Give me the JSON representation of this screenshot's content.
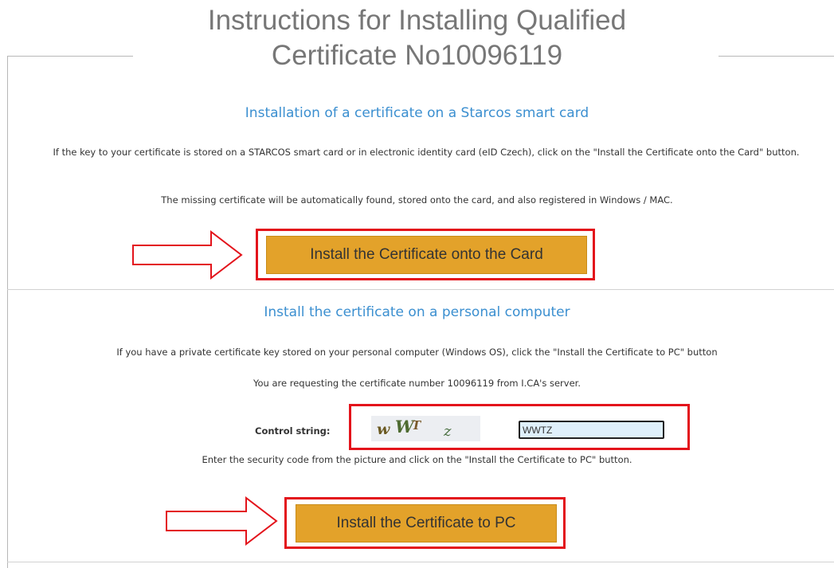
{
  "page": {
    "title": "Instructions for Installing Qualified\nCertificate No10096119"
  },
  "card_section": {
    "title": "Installation of a certificate on a Starcos smart card",
    "paragraph_1": "If the key to your certificate is stored on a STARCOS smart card or in electronic identity card (eID Czech), click on the \"Install the Certificate onto the Card\" button.",
    "paragraph_2": "The missing certificate will be automatically found, stored onto the card, and also registered in Windows / MAC.",
    "button_label": "Install the Certificate onto the Card"
  },
  "pc_section": {
    "title": "Install the certificate on a personal computer",
    "paragraph_1": "If you have a private certificate key stored on your personal computer (Windows OS), click the \"Install the Certificate to PC\" button",
    "paragraph_2": "You are requesting the certificate number 10096119 from I.CA's server.",
    "control_string_label": "Control string:",
    "captcha_input_value": "WWTZ",
    "paragraph_3": "Enter the security code from the picture and click on the \"Install the Certificate to PC\" button.",
    "button_label": "Install the Certificate to PC"
  },
  "colors": {
    "accent_title": "#3b8fd0",
    "button_fill": "#e3a22a",
    "highlight_red": "#e3131b"
  }
}
